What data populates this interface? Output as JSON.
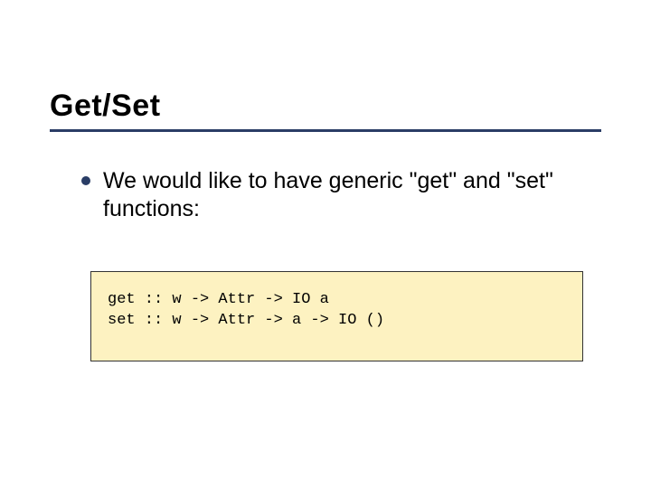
{
  "slide": {
    "title": "Get/Set",
    "bullet_text": "We would like to have generic \"get\" and \"set\" functions:",
    "code": {
      "line1": "get :: w -> Attr -> IO a",
      "line2": "set :: w -> Attr -> a -> IO ()"
    }
  }
}
